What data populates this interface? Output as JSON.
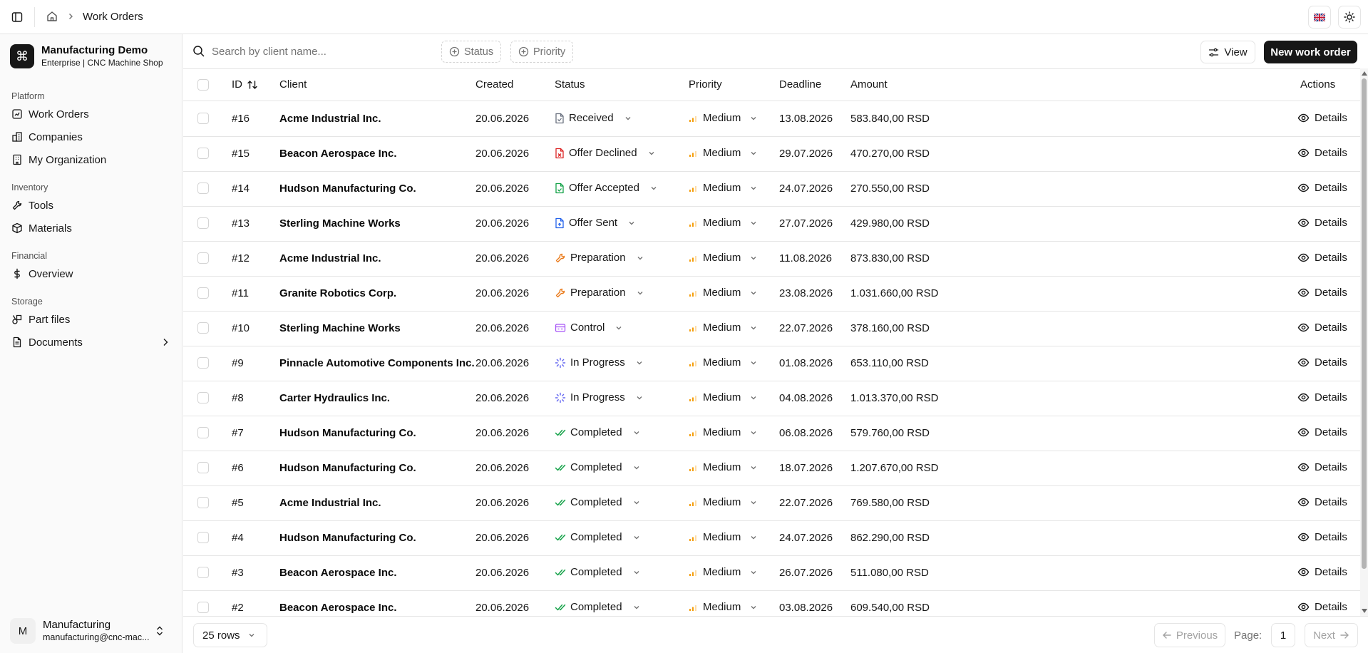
{
  "topbar": {
    "breadcrumb_current": "Work Orders"
  },
  "org": {
    "name": "Manufacturing Demo",
    "subtitle": "Enterprise | CNC Machine Shop",
    "logo_glyph": "⌘"
  },
  "sidebar": {
    "groups": [
      {
        "title": "Platform",
        "items": [
          {
            "label": "Work Orders",
            "icon": "work-orders-icon"
          },
          {
            "label": "Companies",
            "icon": "building-icon"
          },
          {
            "label": "My Organization",
            "icon": "organization-icon"
          }
        ]
      },
      {
        "title": "Inventory",
        "items": [
          {
            "label": "Tools",
            "icon": "wrench-icon"
          },
          {
            "label": "Materials",
            "icon": "box-icon"
          }
        ]
      },
      {
        "title": "Financial",
        "items": [
          {
            "label": "Overview",
            "icon": "dollar-icon"
          }
        ]
      },
      {
        "title": "Storage",
        "items": [
          {
            "label": "Part files",
            "icon": "shapes-icon"
          },
          {
            "label": "Documents",
            "icon": "document-icon"
          }
        ]
      }
    ]
  },
  "user": {
    "initial": "M",
    "name": "Manufacturing",
    "email": "manufacturing@cnc-mac..."
  },
  "toolbar": {
    "search_placeholder": "Search by client name...",
    "filter_status": "Status",
    "filter_priority": "Priority",
    "view_label": "View",
    "new_label": "New work order"
  },
  "table": {
    "headers": {
      "id": "ID",
      "client": "Client",
      "created": "Created",
      "status": "Status",
      "priority": "Priority",
      "deadline": "Deadline",
      "amount": "Amount",
      "actions": "Actions"
    },
    "details_label": "Details",
    "rows": [
      {
        "id": "#16",
        "client": "Acme Industrial Inc.",
        "created": "20.06.2026",
        "status": "Received",
        "status_icon": "received",
        "priority": "Medium",
        "deadline": "13.08.2026",
        "amount": "583.840,00 RSD"
      },
      {
        "id": "#15",
        "client": "Beacon Aerospace Inc.",
        "created": "20.06.2026",
        "status": "Offer Declined",
        "status_icon": "declined",
        "priority": "Medium",
        "deadline": "29.07.2026",
        "amount": "470.270,00 RSD"
      },
      {
        "id": "#14",
        "client": "Hudson Manufacturing Co.",
        "created": "20.06.2026",
        "status": "Offer Accepted",
        "status_icon": "accepted",
        "priority": "Medium",
        "deadline": "24.07.2026",
        "amount": "270.550,00 RSD"
      },
      {
        "id": "#13",
        "client": "Sterling Machine Works",
        "created": "20.06.2026",
        "status": "Offer Sent",
        "status_icon": "sent",
        "priority": "Medium",
        "deadline": "27.07.2026",
        "amount": "429.980,00 RSD"
      },
      {
        "id": "#12",
        "client": "Acme Industrial Inc.",
        "created": "20.06.2026",
        "status": "Preparation",
        "status_icon": "preparation",
        "priority": "Medium",
        "deadline": "11.08.2026",
        "amount": "873.830,00 RSD"
      },
      {
        "id": "#11",
        "client": "Granite Robotics Corp.",
        "created": "20.06.2026",
        "status": "Preparation",
        "status_icon": "preparation",
        "priority": "Medium",
        "deadline": "23.08.2026",
        "amount": "1.031.660,00 RSD"
      },
      {
        "id": "#10",
        "client": "Sterling Machine Works",
        "created": "20.06.2026",
        "status": "Control",
        "status_icon": "control",
        "priority": "Medium",
        "deadline": "22.07.2026",
        "amount": "378.160,00 RSD"
      },
      {
        "id": "#9",
        "client": "Pinnacle Automotive Components Inc.",
        "created": "20.06.2026",
        "status": "In Progress",
        "status_icon": "progress",
        "priority": "Medium",
        "deadline": "01.08.2026",
        "amount": "653.110,00 RSD"
      },
      {
        "id": "#8",
        "client": "Carter Hydraulics Inc.",
        "created": "20.06.2026",
        "status": "In Progress",
        "status_icon": "progress",
        "priority": "Medium",
        "deadline": "04.08.2026",
        "amount": "1.013.370,00 RSD"
      },
      {
        "id": "#7",
        "client": "Hudson Manufacturing Co.",
        "created": "20.06.2026",
        "status": "Completed",
        "status_icon": "completed",
        "priority": "Medium",
        "deadline": "06.08.2026",
        "amount": "579.760,00 RSD"
      },
      {
        "id": "#6",
        "client": "Hudson Manufacturing Co.",
        "created": "20.06.2026",
        "status": "Completed",
        "status_icon": "completed",
        "priority": "Medium",
        "deadline": "18.07.2026",
        "amount": "1.207.670,00 RSD"
      },
      {
        "id": "#5",
        "client": "Acme Industrial Inc.",
        "created": "20.06.2026",
        "status": "Completed",
        "status_icon": "completed",
        "priority": "Medium",
        "deadline": "22.07.2026",
        "amount": "769.580,00 RSD"
      },
      {
        "id": "#4",
        "client": "Hudson Manufacturing Co.",
        "created": "20.06.2026",
        "status": "Completed",
        "status_icon": "completed",
        "priority": "Medium",
        "deadline": "24.07.2026",
        "amount": "862.290,00 RSD"
      },
      {
        "id": "#3",
        "client": "Beacon Aerospace Inc.",
        "created": "20.06.2026",
        "status": "Completed",
        "status_icon": "completed",
        "priority": "Medium",
        "deadline": "26.07.2026",
        "amount": "511.080,00 RSD"
      },
      {
        "id": "#2",
        "client": "Beacon Aerospace Inc.",
        "created": "20.06.2026",
        "status": "Completed",
        "status_icon": "completed",
        "priority": "Medium",
        "deadline": "03.08.2026",
        "amount": "609.540,00 RSD"
      }
    ]
  },
  "footer": {
    "rows_label": "25 rows",
    "previous_label": "Previous",
    "page_label": "Page:",
    "page_number": "1",
    "next_label": "Next"
  },
  "colors": {
    "primary": "#171717",
    "border": "#e5e5e5",
    "priority_medium": "#f59e0b",
    "status_received": "#6b7280",
    "status_declined": "#dc2626",
    "status_accepted": "#16a34a",
    "status_sent": "#2563eb",
    "status_preparation": "#ea7a1a",
    "status_control": "#a855f7",
    "status_progress": "#6366f1",
    "status_completed": "#16a34a"
  }
}
